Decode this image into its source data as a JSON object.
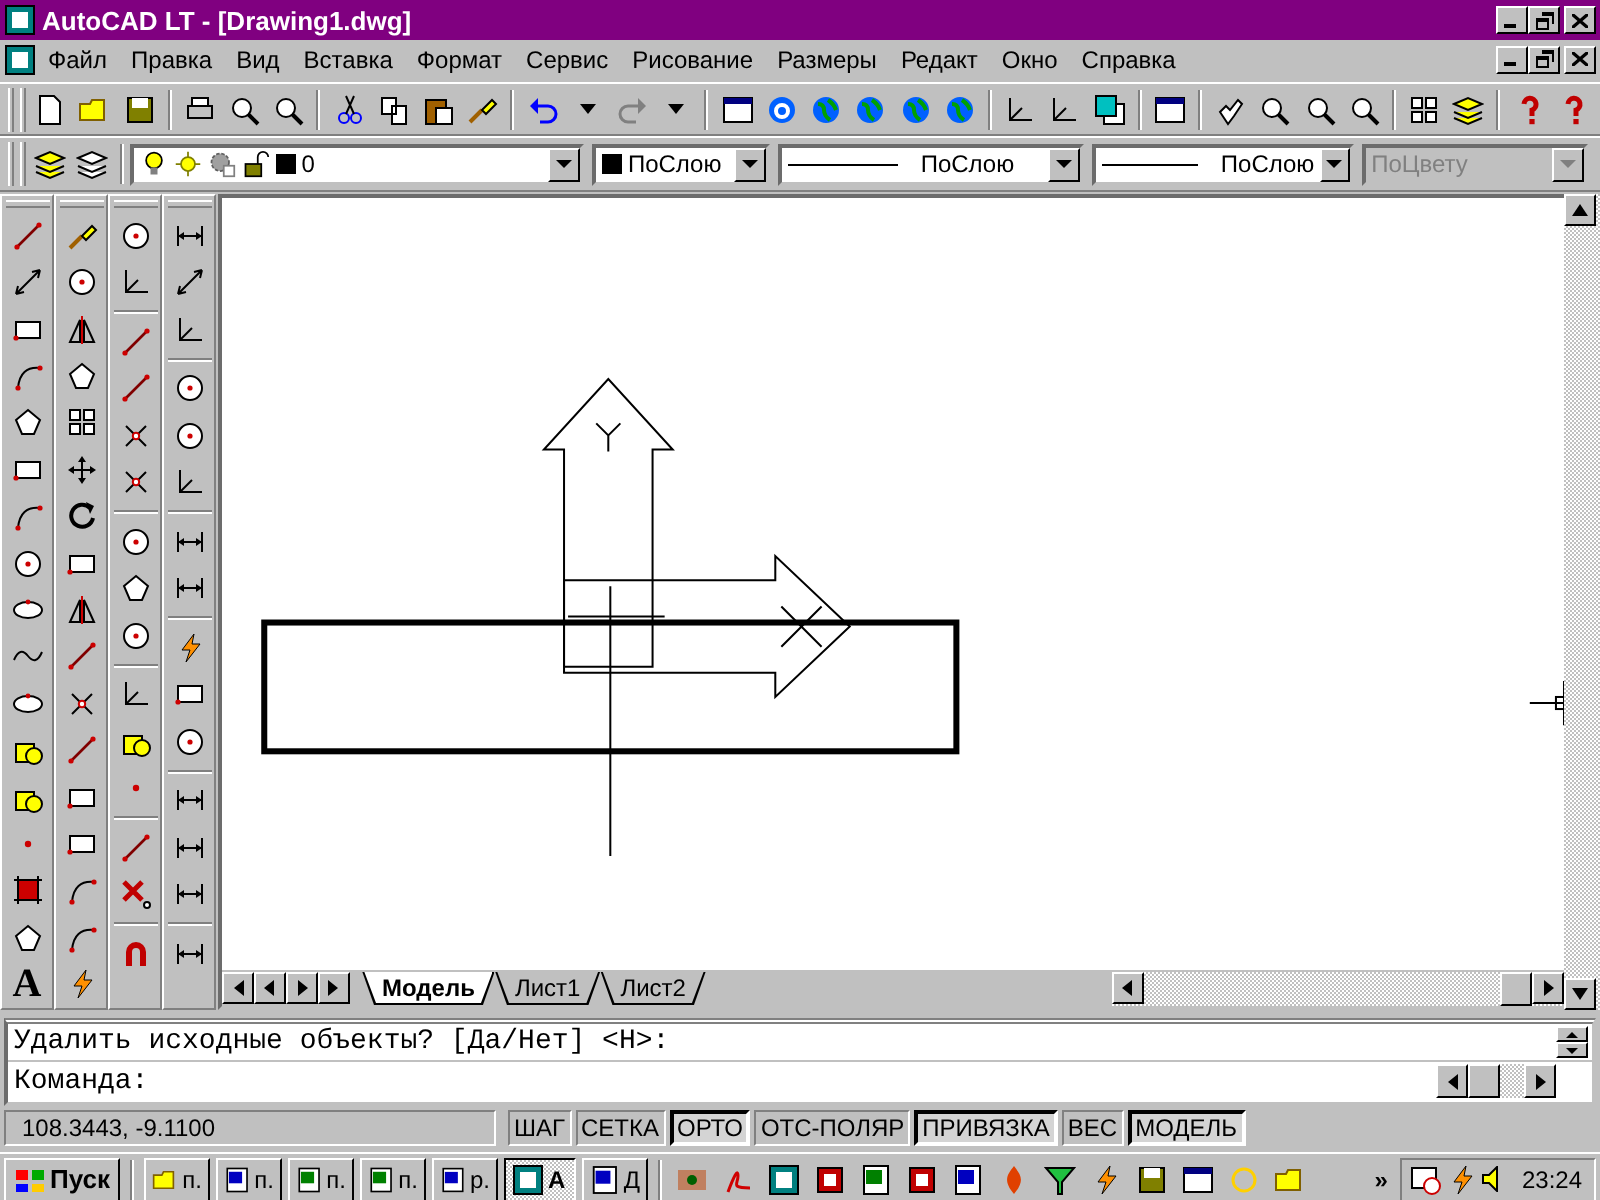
{
  "window": {
    "title": "AutoCAD LT - [Drawing1.dwg]"
  },
  "menu": [
    {
      "label": "Файл"
    },
    {
      "label": "Правка"
    },
    {
      "label": "Вид"
    },
    {
      "label": "Вставка"
    },
    {
      "label": "Формат"
    },
    {
      "label": "Сервис"
    },
    {
      "label": "Рисование"
    },
    {
      "label": "Размеры"
    },
    {
      "label": "Редакт"
    },
    {
      "label": "Окно"
    },
    {
      "label": "Справка"
    }
  ],
  "layers_toolbar": {
    "layer": "0",
    "color_setting": "ПоСлою",
    "linetype": "ПоСлою",
    "lineweight": "ПоСлою",
    "plot_style": {
      "value": "ПоЦвету",
      "disabled": true
    }
  },
  "draw_toolbar": {
    "text_tool": "A"
  },
  "layout_tabs": [
    {
      "label": "Модель",
      "selected": true
    },
    {
      "label": "Лист1",
      "selected": false
    },
    {
      "label": "Лист2",
      "selected": false
    }
  ],
  "command_line": {
    "history": "Удалить исходные объекты? [Да/Нет] <Н>:",
    "prompt": "Команда:"
  },
  "status_bar": {
    "coordinates": "108.3443, -9.1100",
    "toggles": [
      {
        "label": "ШАГ",
        "on": false
      },
      {
        "label": "СЕТКА",
        "on": false
      },
      {
        "label": "ОРТО",
        "on": true
      },
      {
        "label": "ОТС-ПОЛЯР",
        "on": false
      },
      {
        "label": "ПРИВЯЗКА",
        "on": true
      },
      {
        "label": "ВЕС",
        "on": false
      },
      {
        "label": "МОДЕЛЬ",
        "on": true
      }
    ]
  },
  "taskbar": {
    "start": "Пуск",
    "buttons": [
      {
        "label": "п.",
        "kind": "folder",
        "selected": false
      },
      {
        "label": "п.",
        "kind": "word",
        "selected": false
      },
      {
        "label": "п.",
        "kind": "excel",
        "selected": false
      },
      {
        "label": "п.",
        "kind": "excel",
        "selected": false
      },
      {
        "label": "р.",
        "kind": "word",
        "selected": false
      },
      {
        "label": "A",
        "kind": "acad",
        "selected": true
      },
      {
        "label": "Д",
        "kind": "word",
        "selected": false
      }
    ],
    "more": "»",
    "clock": "23:24"
  }
}
